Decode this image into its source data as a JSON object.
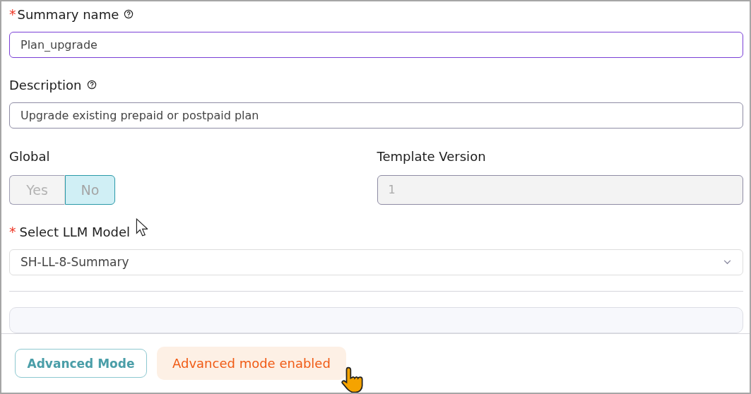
{
  "summary_name": {
    "label": "Summary name",
    "required_mark": "*",
    "help": true,
    "value": "Plan_upgrade",
    "focused": true
  },
  "description": {
    "label": "Description",
    "help": true,
    "value": "Upgrade existing prepaid or postpaid plan",
    "focused": false
  },
  "global": {
    "label": "Global",
    "options": [
      {
        "label": "Yes",
        "selected": false
      },
      {
        "label": "No",
        "selected": true
      }
    ]
  },
  "template_version": {
    "label": "Template Version",
    "value": "1",
    "disabled": true
  },
  "llm_model": {
    "label": "Select LLM Model",
    "required_mark": "*",
    "value": "SH-LL-8-Summary"
  },
  "footer": {
    "button": "Advanced Mode",
    "status": "Advanced mode enabled"
  }
}
